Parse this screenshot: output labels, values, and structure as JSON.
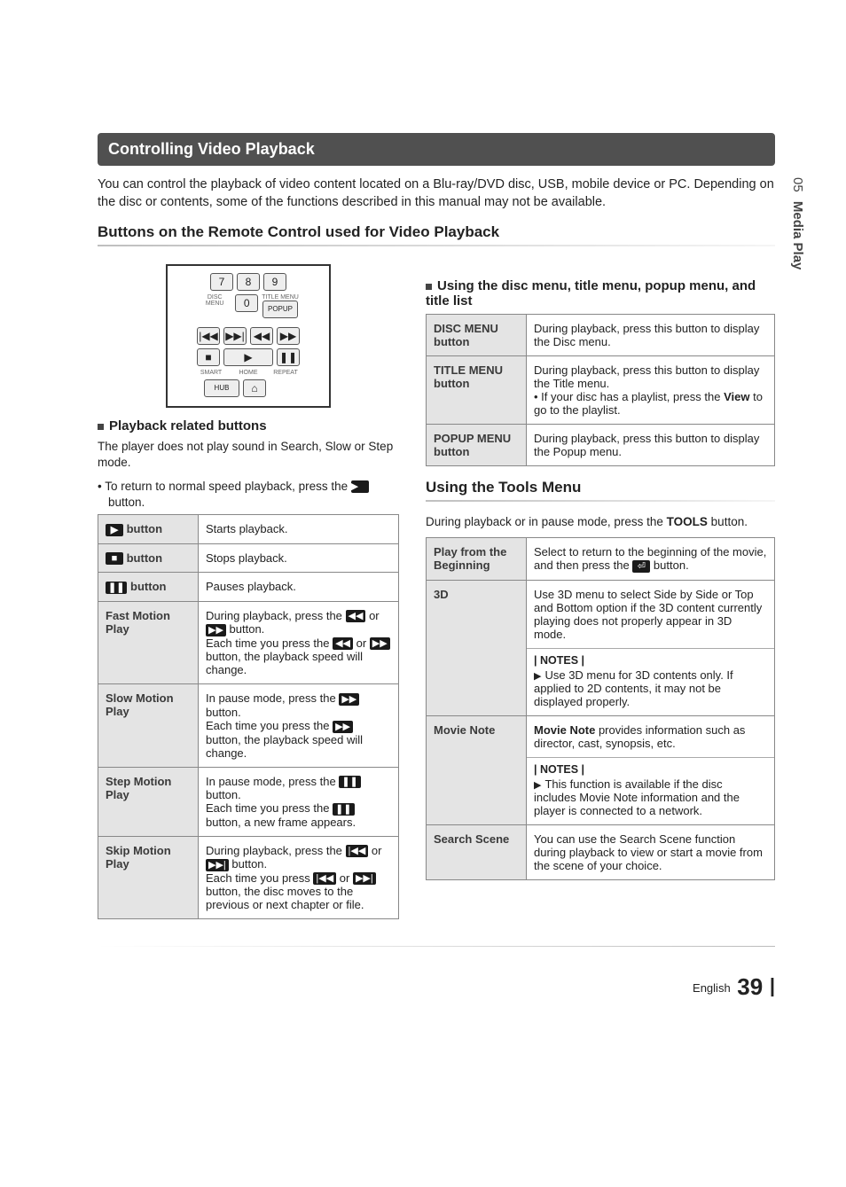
{
  "chapter_tab": {
    "num": "05",
    "title": "Media Play"
  },
  "section_title": "Controlling Video Playback",
  "intro": "You can control the playback of video content located on a Blu-ray/DVD disc, USB, mobile device or PC. Depending on the disc or contents, some of the functions described in this manual may not be available.",
  "remote_heading": "Buttons on the Remote Control used for Video Playback",
  "remote": {
    "row1": [
      "7",
      "8",
      "9"
    ],
    "labels1": [
      "DISC MENU",
      "",
      "TITLE MENU"
    ],
    "row2_mid": "0",
    "row2_right": "POPUP",
    "row3": [
      "|◀◀",
      "▶▶|",
      "◀◀",
      "▶▶"
    ],
    "row4_stop": "■",
    "row4_play": "▶",
    "row4_pause": "❚❚",
    "labels2": [
      "SMART",
      "HOME",
      "REPEAT"
    ],
    "row5": [
      "HUB",
      "⌂",
      ""
    ]
  },
  "left": {
    "sub1": "Playback related buttons",
    "para1": "The player does not play sound in Search, Slow or Step mode.",
    "bullet1_a": "To return to normal speed playback, press the ",
    "bullet1_b": " button.",
    "table": [
      {
        "label": "▶ button",
        "icon": "▶",
        "desc": "Starts playback."
      },
      {
        "label": "■ button",
        "icon": "■",
        "desc": "Stops playback."
      },
      {
        "label": "❚❚ button",
        "icon": "❚❚",
        "desc": "Pauses playback."
      },
      {
        "label_plain": "Fast Motion Play",
        "desc": "During playback, press the ◀◀ or ▶▶ button.\nEach time you press the ◀◀ or ▶▶ button, the playback speed will change.",
        "icons": [
          "◀◀",
          "▶▶",
          "◀◀",
          "▶▶"
        ]
      },
      {
        "label_plain": "Slow Motion Play",
        "desc": "In pause mode, press the ▶▶ button.\nEach time you press the ▶▶ button, the playback speed will change.",
        "icons": [
          "▶▶",
          "▶▶"
        ]
      },
      {
        "label_plain": "Step Motion Play",
        "desc": "In pause mode, press the ❚❚ button.\nEach time you press the ❚❚ button, a new frame appears.",
        "icons": [
          "❚❚",
          "❚❚"
        ]
      },
      {
        "label_plain": "Skip Motion Play",
        "desc": "During playback, press the |◀◀ or ▶▶| button.\nEach time you press |◀◀ or ▶▶| button, the disc moves to the previous or next chapter or file.",
        "icons": [
          "|◀◀",
          "▶▶|",
          "|◀◀",
          "▶▶|"
        ]
      }
    ]
  },
  "right": {
    "sub1": "Using the disc menu, title menu, popup menu, and title list",
    "menu_table": [
      {
        "label": "DISC MENU button",
        "desc": "During playback, press this button to display the Disc menu."
      },
      {
        "label": "TITLE MENU button",
        "desc_parts": [
          "During playback, press this button to display the Title menu.",
          "• If your disc has a playlist, press the ",
          "View",
          " to go to the playlist."
        ]
      },
      {
        "label": "POPUP MENU button",
        "desc": "During playback, press this button to display the Popup menu."
      }
    ],
    "tools_heading": "Using the Tools Menu",
    "tools_intro_a": "During playback or in pause mode, press the ",
    "tools_intro_b": "TOOLS",
    "tools_intro_c": " button.",
    "tools_table": [
      {
        "label": "Play from the Beginning",
        "desc_a": "Select to return to the beginning of the movie, and then press the ",
        "desc_b": " button.",
        "icon": "⏎"
      },
      {
        "label": "3D",
        "desc": "Use 3D menu to select Side by Side or Top and Bottom option if the 3D content currently playing does not properly appear in 3D mode.",
        "notes": "| NOTES |",
        "note_item": "Use 3D menu for 3D contents only. If applied to 2D contents, it may not be displayed properly."
      },
      {
        "label": "Movie Note",
        "lead_bold": "Movie Note",
        "lead_rest": " provides information such as director, cast, synopsis, etc.",
        "notes": "| NOTES |",
        "note_item": "This function is available if the disc includes Movie Note information and the player is connected to a network."
      },
      {
        "label": "Search Scene",
        "desc": "You can use the Search Scene function during playback to view or start a movie from the scene of your choice."
      }
    ]
  },
  "footer": {
    "lang": "English",
    "page": "39"
  }
}
